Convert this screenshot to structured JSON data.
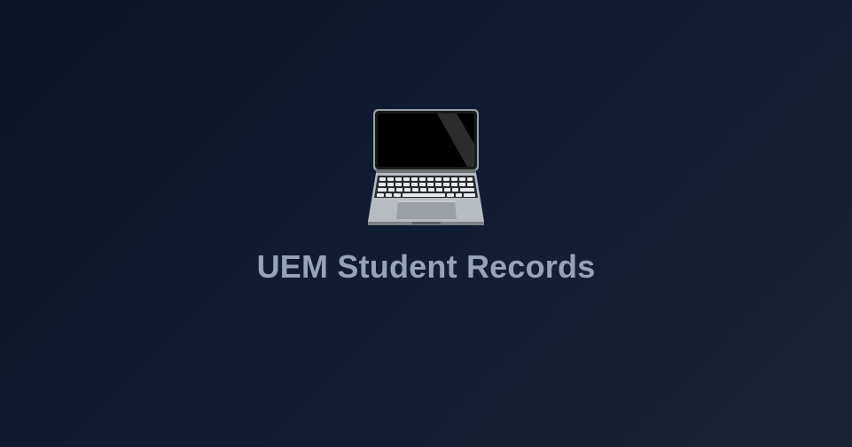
{
  "splash": {
    "icon": "laptop-icon",
    "app_title": "UEM Student Records"
  },
  "colors": {
    "background_start": "#0c1628",
    "background_end": "#1a2336",
    "title": "#94a3b8"
  }
}
